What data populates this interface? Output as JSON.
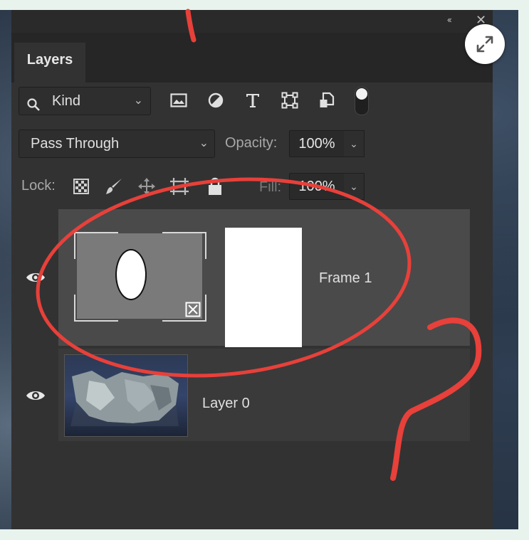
{
  "panel": {
    "tab_label": "Layers",
    "collapse_glyph": "‹‹",
    "close_glyph": "✕"
  },
  "filter": {
    "kind_label": "Kind",
    "icons": [
      "image-filter-icon",
      "adjustment-filter-icon",
      "type-filter-icon",
      "shape-filter-icon",
      "smart-object-filter-icon"
    ]
  },
  "blend": {
    "mode": "Pass Through",
    "opacity_label": "Opacity:",
    "opacity_value": "100%"
  },
  "lock": {
    "label": "Lock:",
    "fill_label": "Fill:",
    "fill_value": "100%"
  },
  "layers": [
    {
      "name": "Frame 1",
      "visible": true,
      "selected": true
    },
    {
      "name": "Layer 0",
      "visible": true,
      "selected": false
    }
  ],
  "colors": {
    "panel_bg": "#323232",
    "selected_row": "#4a4a4a",
    "annotation_red": "#e8403a"
  }
}
